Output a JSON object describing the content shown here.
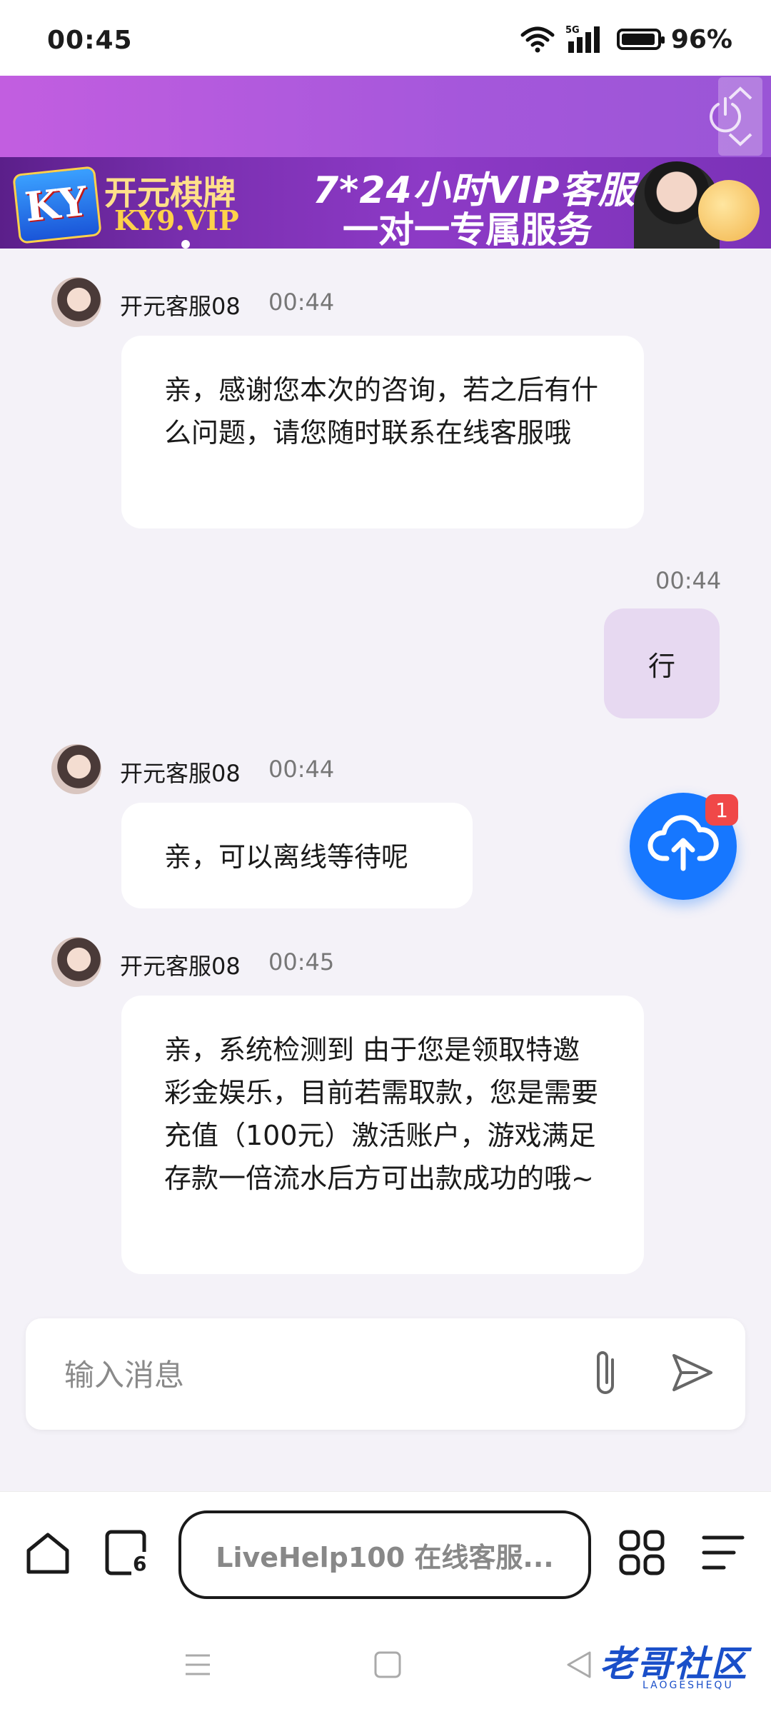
{
  "status_bar": {
    "time": "00:45",
    "network": "5G",
    "battery": "96%"
  },
  "banner": {
    "brand_logo": "KY",
    "brand_name": "开元棋牌",
    "brand_url": "KY9.VIP",
    "promo_line1": "7*24小时VIP客服",
    "promo_line2": "一对一专属服务"
  },
  "messages": [
    {
      "sender": "开元客服08",
      "time": "00:44",
      "text": "亲，感谢您本次的咨询，若之后有什么问题，请您随时联系在线客服哦"
    },
    {
      "time": "00:44",
      "text": "行"
    },
    {
      "sender": "开元客服08",
      "time": "00:44",
      "text": "亲，可以离线等待呢"
    },
    {
      "sender": "开元客服08",
      "time": "00:45",
      "text": "亲，系统检测到 由于您是领取特邀彩金娱乐，目前若需取款，您是需要充值（100元）激活账户，游戏满足存款一倍流水后方可出款成功的哦~"
    }
  ],
  "upload_fab": {
    "badge": "1"
  },
  "composer": {
    "placeholder": "输入消息"
  },
  "browser": {
    "tab_count": "6",
    "url_label": "LiveHelp100 在线客服..."
  },
  "watermark": {
    "text": "老哥社区",
    "sub": "LAOGESHEQU"
  },
  "colors": {
    "accent_purple": "#a557db",
    "outgoing_bubble": "#e7d9f1",
    "fab_blue": "#1677ff",
    "badge_red": "#f04848"
  }
}
